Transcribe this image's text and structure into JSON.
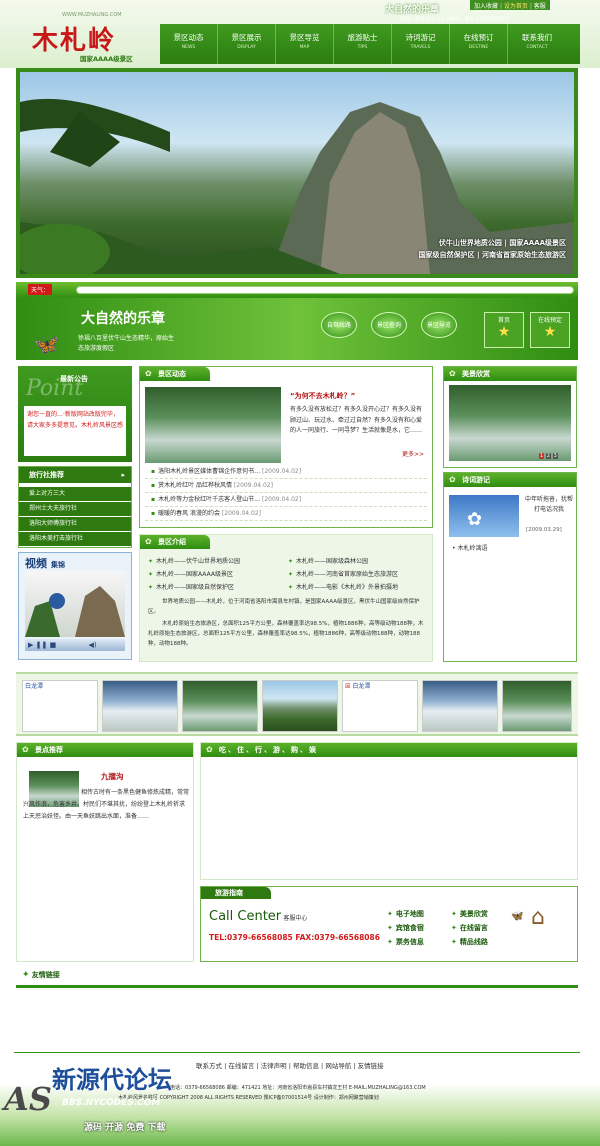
{
  "header": {
    "logo_text": "木札岭",
    "logo_url": "WWW.MUZHALING.COM",
    "grade_label": "国家AAAA级景区",
    "slogan_script": "大自然的乐章",
    "slogan_sub": "徐福八百里伏牛山生态精华，原始生态旅游度假区",
    "top_links": [
      "加入收藏",
      "设为首页",
      "客服"
    ],
    "nav": [
      {
        "zh": "景区动态",
        "en": "NEWS"
      },
      {
        "zh": "景区展示",
        "en": "DISPLAY"
      },
      {
        "zh": "景区导览",
        "en": "MAP"
      },
      {
        "zh": "旅游贴士",
        "en": "TIPS"
      },
      {
        "zh": "诗词游记",
        "en": "TRAVELS"
      },
      {
        "zh": "在线预订",
        "en": "DESTINE"
      },
      {
        "zh": "联系我们",
        "en": "CONTACT"
      }
    ]
  },
  "banner": {
    "caption_line1": "伏牛山世界地质公园 | 国家AAAA级景区",
    "caption_line2": "国家级自然保护区 | 河南省首家原始生态旅游区"
  },
  "search_bar": {
    "label": "天气："
  },
  "sub_banner": {
    "script": "大自然的乐章",
    "sub1": "徐福八百里伏牛山生态精华，原始生",
    "sub2": "态旅游度假区",
    "buttons": [
      "自驾线路",
      "景区查询",
      "景区导览"
    ],
    "stars": [
      "首页",
      "在线预定"
    ]
  },
  "notice": {
    "title_zh": "最新公告",
    "title_en": "Point",
    "text": "谢您一直的…·新版网站改版完毕，请大家多多提意见。木札岭风景区感"
  },
  "agency": {
    "title": "旅行社推荐",
    "items": [
      "爱上对方三大",
      "郑州士大夫旅行社",
      "洛阳大师傅旅行社",
      "洛阳木美打击旅行社"
    ]
  },
  "video": {
    "title": "视频",
    "title2": "集锦"
  },
  "news": {
    "title": "景区动态",
    "headline": "“为何不去木札岭？”",
    "summary": "有多久没有放松过？有多久没开心过？有多久没有顾过山、玩过水、牵过过自然？有多久没有和心爱的人一同旅行、一同寻梦？生活就像是水，它……",
    "more": "更多>>",
    "items": [
      {
        "title": "洛阳木札岭景区媒体曹锦企作意何书…",
        "date": "[2009.04.02]"
      },
      {
        "title": "赏木札岭红叶 品红桦秋风情",
        "date": "[2009.04.02]"
      },
      {
        "title": "木札岭等力金秋红叶千志客人登山节…",
        "date": "[2009.04.02]"
      },
      {
        "title": "暖暖的春风 浪漫的约会",
        "date": "[2009.04.02]"
      }
    ]
  },
  "intro": {
    "title": "景区介绍",
    "items": [
      "木札岭——伏牛山世界地质公园",
      "木札岭——国家级森林公园",
      "木札岭——国家AAAA级景区",
      "木札岭——河南省首家原始生态旅游区",
      "木札岭——国家级自然保护区",
      "木札岭——电影《木札岭》外景拍摄地"
    ],
    "para1": "世界地质公园——木札岭，位于河南省洛阳市嵩县车村镇，是国家AAAA级景区，黑伏牛山国家级自然保护区。",
    "para2": "木札岭原始生态旅游区，总面积125平方公里，森林覆盖率达98.5%，植物1886种，高等级动物188种，木札岭原始生态旅游区，总面积125平方公里，森林覆盖率达98.5%，植物1886种，高等级动物188种，动物188种，动物188种。"
  },
  "scenery": {
    "title": "美景欣赏",
    "pages": [
      "1",
      "2",
      "3"
    ]
  },
  "poems": {
    "title": "诗词游记",
    "text": "中年听拖沓，犹帮打电话况我",
    "date": "[2009.03.29]",
    "link": "木札岭漓语"
  },
  "strip": {
    "labels": [
      "白龙潭",
      "白龙潭"
    ]
  },
  "recommend": {
    "title": "景点推荐",
    "name": "九擂沟",
    "desc": "相传古时有一条黑色健鱼修炼成精，常常兴风作浪，危害乡井，村民们不堪其扰，纷纷登上木札岭祈求上天惩治妖怪。由一天鱼妖跳出水面，准备……"
  },
  "food": {
    "title": "吃、住、行、游、购、娱"
  },
  "guide": {
    "title": "旅游指南",
    "call_center": "Call Center",
    "call_sub": "客服中心",
    "tel": "TEL:0379-66568085 FAX:0379-66568086",
    "links": [
      "电子地图",
      "美景欣赏",
      "宾馆食宿",
      "在线留言",
      "票务信息",
      "精品线路"
    ]
  },
  "friends": {
    "title": "友情链接"
  },
  "footer": {
    "links": [
      "联系方式",
      "在线留言",
      "法律声明",
      "帮助信息",
      "网站导航",
      "友情链接"
    ],
    "info1": "电话：0379-66568086  邮编：471421  地址：河南省洛阳市嵩县车村镇龙王村  E-MAIL:MUZHALING@163.COM",
    "info2": "木札岭风景名胜区 COPYRIGHT 2008 ALL RIGHTS RESERVED  豫ICP备07001514号  设计制作：郑州网聚营销策划",
    "watermark": "新源代论坛",
    "watermark_url": "BBS.NYCODES.COM",
    "watermark_tags": [
      "源码",
      "开源",
      "免费",
      "下载"
    ]
  },
  "colors": {
    "primary": "#2f8d12",
    "accent": "#5db12b",
    "red": "#d21a1a"
  }
}
